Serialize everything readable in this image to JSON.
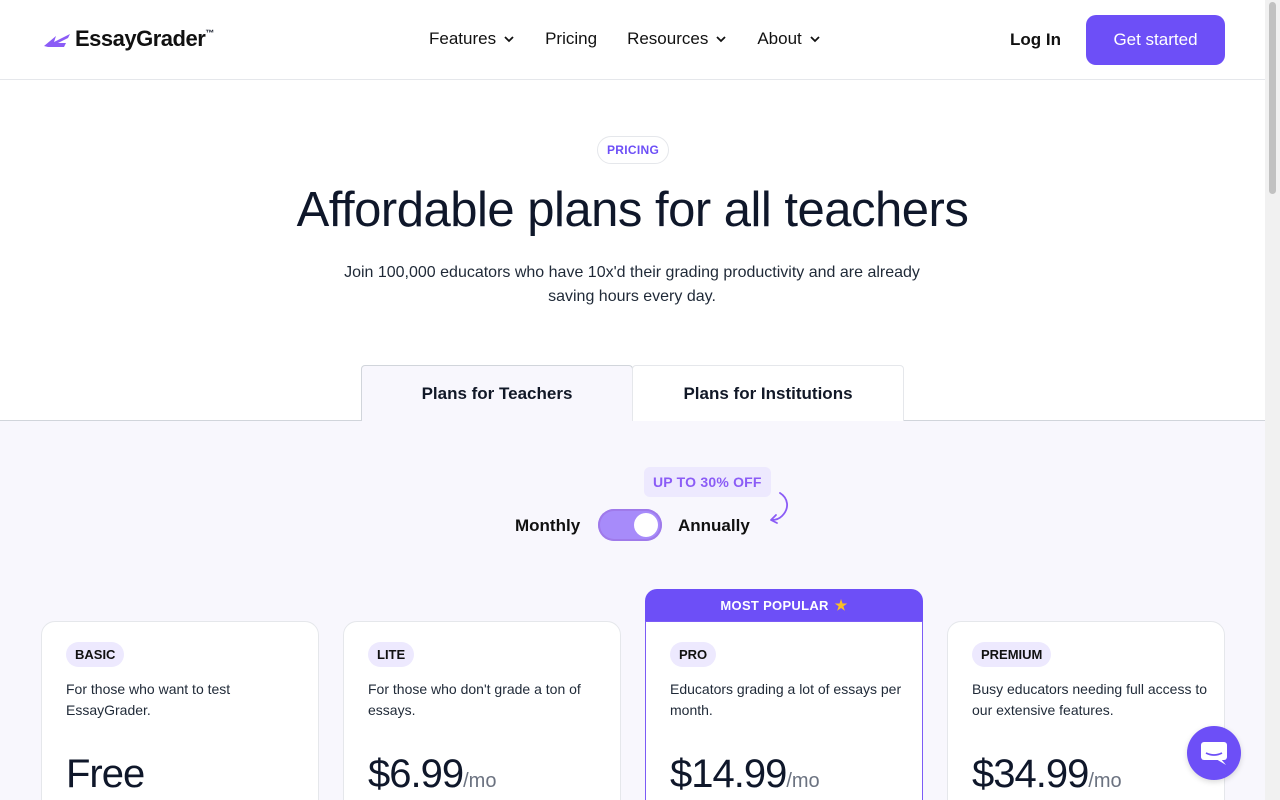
{
  "header": {
    "logo_text": "EssayGrader",
    "logo_tm": "™",
    "nav": [
      {
        "label": "Features",
        "has_menu": true
      },
      {
        "label": "Pricing",
        "has_menu": false
      },
      {
        "label": "Resources",
        "has_menu": true
      },
      {
        "label": "About",
        "has_menu": true
      }
    ],
    "login_label": "Log In",
    "cta_label": "Get started"
  },
  "hero": {
    "pill": "PRICING",
    "title": "Affordable plans for all teachers",
    "subtitle": "Join 100,000 educators who have 10x'd their grading productivity and are already saving hours every day."
  },
  "tabs": [
    {
      "label": "Plans for Teachers",
      "active": true
    },
    {
      "label": "Plans for Institutions",
      "active": false
    }
  ],
  "billing": {
    "discount": "UP TO 30% OFF",
    "monthly_label": "Monthly",
    "annual_label": "Annually",
    "annual_selected": true
  },
  "plans": [
    {
      "badge": "BASIC",
      "desc": "For those who want to test EssayGrader.",
      "price": "Free",
      "per": ""
    },
    {
      "badge": "LITE",
      "desc": "For those who don't grade a ton of essays.",
      "price": "$6.99",
      "per": "/mo"
    },
    {
      "badge": "PRO",
      "desc": "Educators grading a lot of essays per month.",
      "price": "$14.99",
      "per": "/mo",
      "popular_label": "MOST POPULAR"
    },
    {
      "badge": "PREMIUM",
      "desc": "Busy educators needing full access to our extensive features.",
      "price": "$34.99",
      "per": "/mo"
    }
  ],
  "colors": {
    "accent": "#6d4ff7",
    "toggle": "#a78bfa",
    "badge_bg": "#ede9fe",
    "section_bg": "#f8f7fd"
  },
  "icons": {
    "nav_menu": "chevron-down-icon",
    "popular": "star-icon",
    "chat": "chat-bubble-icon",
    "logo": "logo-mark-icon"
  }
}
